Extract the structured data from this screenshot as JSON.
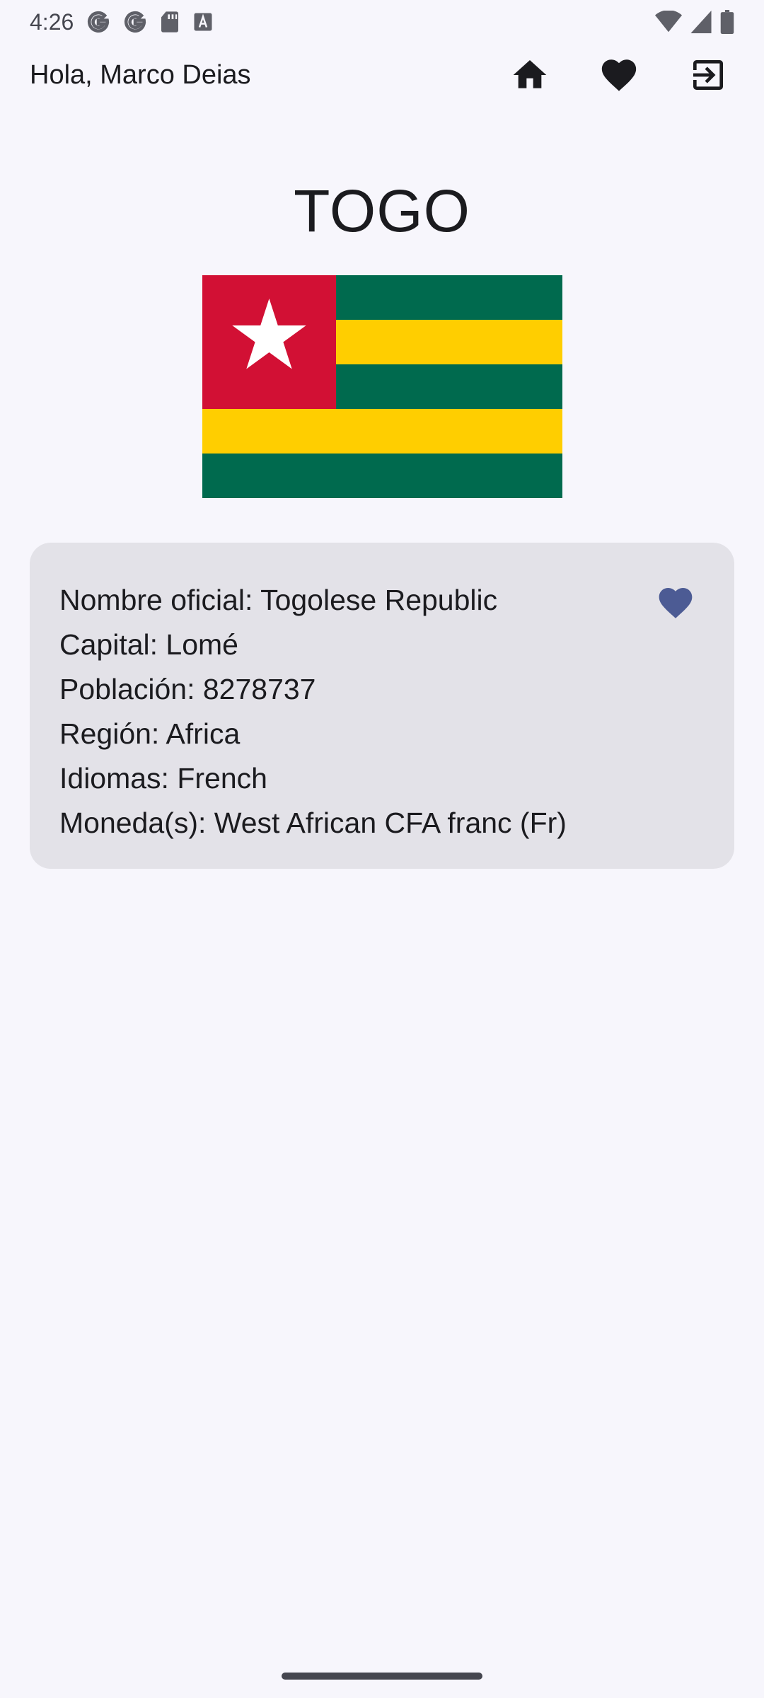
{
  "status_bar": {
    "time": "4:26",
    "icons_left": [
      "google-icon",
      "google-icon",
      "sd-card-icon",
      "font-download-icon"
    ],
    "icons_right": [
      "wifi-icon",
      "signal-icon",
      "battery-icon"
    ]
  },
  "app_bar": {
    "greeting": "Hola, Marco Deias",
    "actions": [
      "home-icon",
      "heart-icon",
      "logout-icon"
    ]
  },
  "country": {
    "name": "TOGO",
    "flag": {
      "colors": {
        "green": "#006a4e",
        "yellow": "#ffce00",
        "red": "#d21034",
        "star": "#ffffff"
      }
    },
    "details": {
      "official_name": "Nombre oficial: Togolese Republic",
      "capital": "Capital: Lomé",
      "population": "Población: 8278737",
      "region": "Región: Africa",
      "languages": "Idiomas: French",
      "currencies": "Moneda(s): West African CFA franc (Fr)"
    },
    "favorite_color": "#4c5b94"
  }
}
